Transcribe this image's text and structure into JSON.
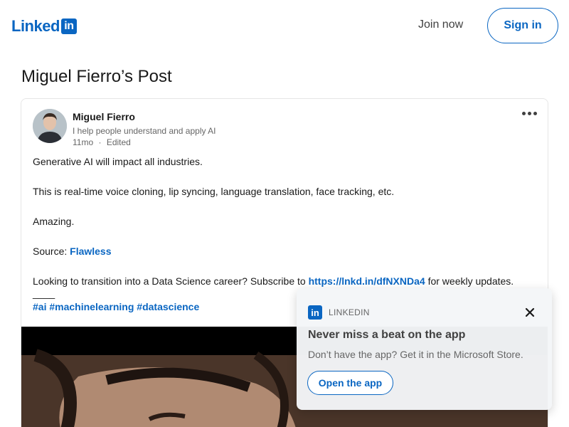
{
  "header": {
    "logo_text": "Linked",
    "logo_box": "in",
    "join_label": "Join now",
    "signin_label": "Sign in"
  },
  "page": {
    "title": "Miguel Fierro’s Post"
  },
  "post": {
    "author": "Miguel Fierro",
    "tagline": "I help people understand and apply AI",
    "age": "11mo",
    "separator": "·",
    "edited": "Edited",
    "body": {
      "line1": "Generative AI will impact all industries.",
      "line2": "This is real-time voice cloning, lip syncing, language translation, face tracking, etc.",
      "line3": "Amazing.",
      "source_label": "Source: ",
      "source_link": "Flawless",
      "cta_prefix": "Looking to transition into a Data Science career? Subscribe to ",
      "cta_link": "https://lnkd.in/dfNXNDa4",
      "cta_suffix": " for weekly updates.",
      "divider": "____",
      "hashtags": [
        "#ai",
        "#machinelearning",
        "#datascience"
      ]
    }
  },
  "popup": {
    "brand": "LINKEDIN",
    "title": "Never miss a beat on the app",
    "text": "Don’t have the app? Get it in the Microsoft Store.",
    "button_label": "Open the app"
  },
  "colors": {
    "brand": "#0a66c2",
    "text": "#191919",
    "muted": "#666666"
  }
}
